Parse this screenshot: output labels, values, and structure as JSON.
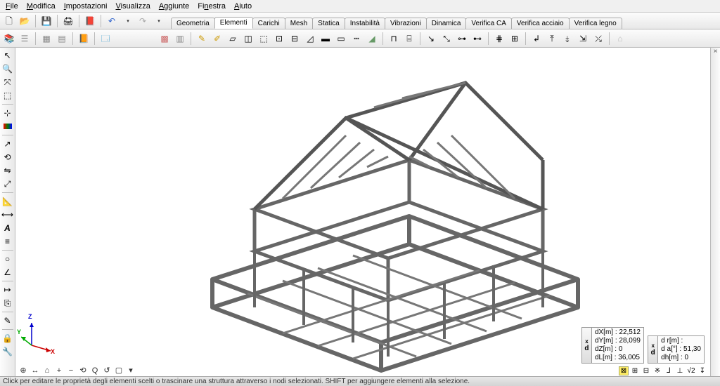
{
  "menu": {
    "file": "File",
    "modifica": "Modifica",
    "impostazioni": "Impostazioni",
    "visualizza": "Visualizza",
    "aggiunte": "Aggiunte",
    "finestra": "Finestra",
    "aiuto": "Aiuto"
  },
  "tabs": {
    "geometria": "Geometria",
    "elementi": "Elementi",
    "carichi": "Carichi",
    "mesh": "Mesh",
    "statica": "Statica",
    "instabilita": "Instabilità",
    "vibrazioni": "Vibrazioni",
    "dinamica": "Dinamica",
    "verificaCA": "Verifica CA",
    "verificaAcciaio": "Verifica acciaio",
    "verificaLegno": "Verifica legno"
  },
  "coords": {
    "box1": {
      "tag": "d",
      "dx_label": "dX[m] :",
      "dx": "22,512",
      "dy_label": "dY[m] :",
      "dy": "28,099",
      "dz_label": "dZ[m] :",
      "dz": "0",
      "dl_label": "dL[m] :",
      "dl": "36,005"
    },
    "box2": {
      "tag": "d",
      "dr_label": "d r[m] :",
      "dr": "",
      "da_label": "d a[°] :",
      "da": "51,30",
      "dh_label": "dh[m] :",
      "dh": "0"
    },
    "close": "x"
  },
  "axis": {
    "x": "X",
    "y": "Y",
    "z": "Z"
  },
  "viewctrls": [
    "⊕",
    "↔",
    "⌂",
    "+",
    "−",
    "⟲",
    "Q",
    "↺",
    "▢",
    "▾"
  ],
  "bottomright": [
    "⊠",
    "⊞",
    "⊟",
    "※",
    "⅃",
    "⊥",
    "√2",
    "↧"
  ],
  "status": "Click per editare le proprietà degli elementi scelti o trascinare una struttura attraverso i nodi selezionati. SHIFT per aggiungere elementi alla selezione."
}
